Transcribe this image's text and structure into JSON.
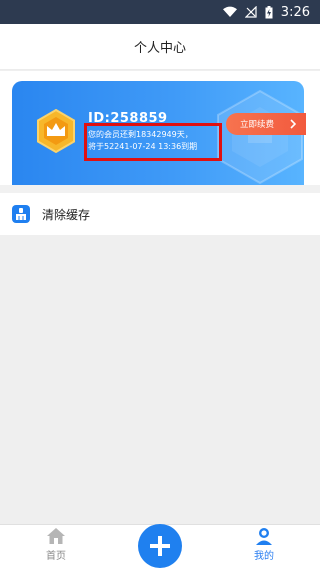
{
  "status_bar": {
    "time": "3:26",
    "icons": [
      "wifi-icon",
      "signal-off-icon",
      "battery-charging-icon"
    ],
    "background": "#2d3a50"
  },
  "header": {
    "title": "个人中心"
  },
  "member_card": {
    "id_label": "ID:258859",
    "remaining_text": "您的会员还剩18342949天，",
    "expiry_text": "将于52241-07-24 13:36到期",
    "renew_label": "立即续费",
    "renew_icon": "chevron-right-icon",
    "badge_icon": "crown-icon",
    "gradient_colors": [
      "#2a86f0",
      "#58b4ff"
    ],
    "badge_colors": [
      "#f7b72b",
      "#f39a12"
    ],
    "renew_color": "#f25a3e",
    "highlight_color": "#e01010"
  },
  "menu": {
    "items": [
      {
        "label": "清除缓存",
        "icon": "cleaner-icon"
      }
    ]
  },
  "tabbar": {
    "tabs": [
      {
        "label": "首页",
        "icon": "home-icon"
      },
      {
        "label": "我的",
        "icon": "user-icon"
      }
    ],
    "center_icon": "plus-icon",
    "active_tab": "我的",
    "active_color": "#2a7ef0",
    "inactive_color": "#8a8a8a"
  }
}
